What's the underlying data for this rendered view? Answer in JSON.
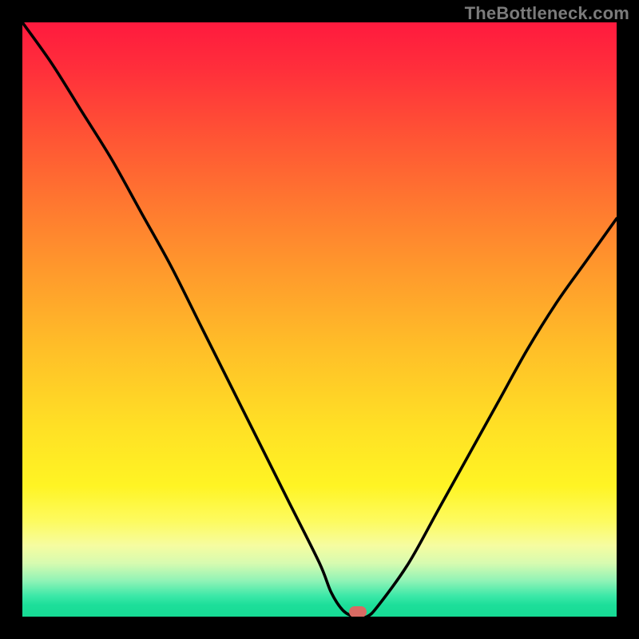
{
  "attribution": "TheBottleneck.com",
  "chart_data": {
    "type": "line",
    "title": "",
    "xlabel": "",
    "ylabel": "",
    "xlim": [
      0,
      100
    ],
    "ylim": [
      0,
      100
    ],
    "series": [
      {
        "name": "bottleneck-curve",
        "x": [
          0,
          5,
          10,
          15,
          20,
          25,
          30,
          35,
          40,
          45,
          50,
          52,
          54,
          56,
          58,
          60,
          65,
          70,
          75,
          80,
          85,
          90,
          95,
          100
        ],
        "y": [
          100,
          93,
          85,
          77,
          68,
          59,
          49,
          39,
          29,
          19,
          9,
          4,
          1,
          0,
          0,
          2,
          9,
          18,
          27,
          36,
          45,
          53,
          60,
          67
        ]
      }
    ],
    "marker": {
      "x": 56.5,
      "y": 0.8,
      "color": "#d96a63"
    },
    "gradient_stops": [
      {
        "pct": 0,
        "color": "#ff1a3e"
      },
      {
        "pct": 50,
        "color": "#ffbf28"
      },
      {
        "pct": 85,
        "color": "#f6fca0"
      },
      {
        "pct": 100,
        "color": "#16da94"
      }
    ]
  }
}
